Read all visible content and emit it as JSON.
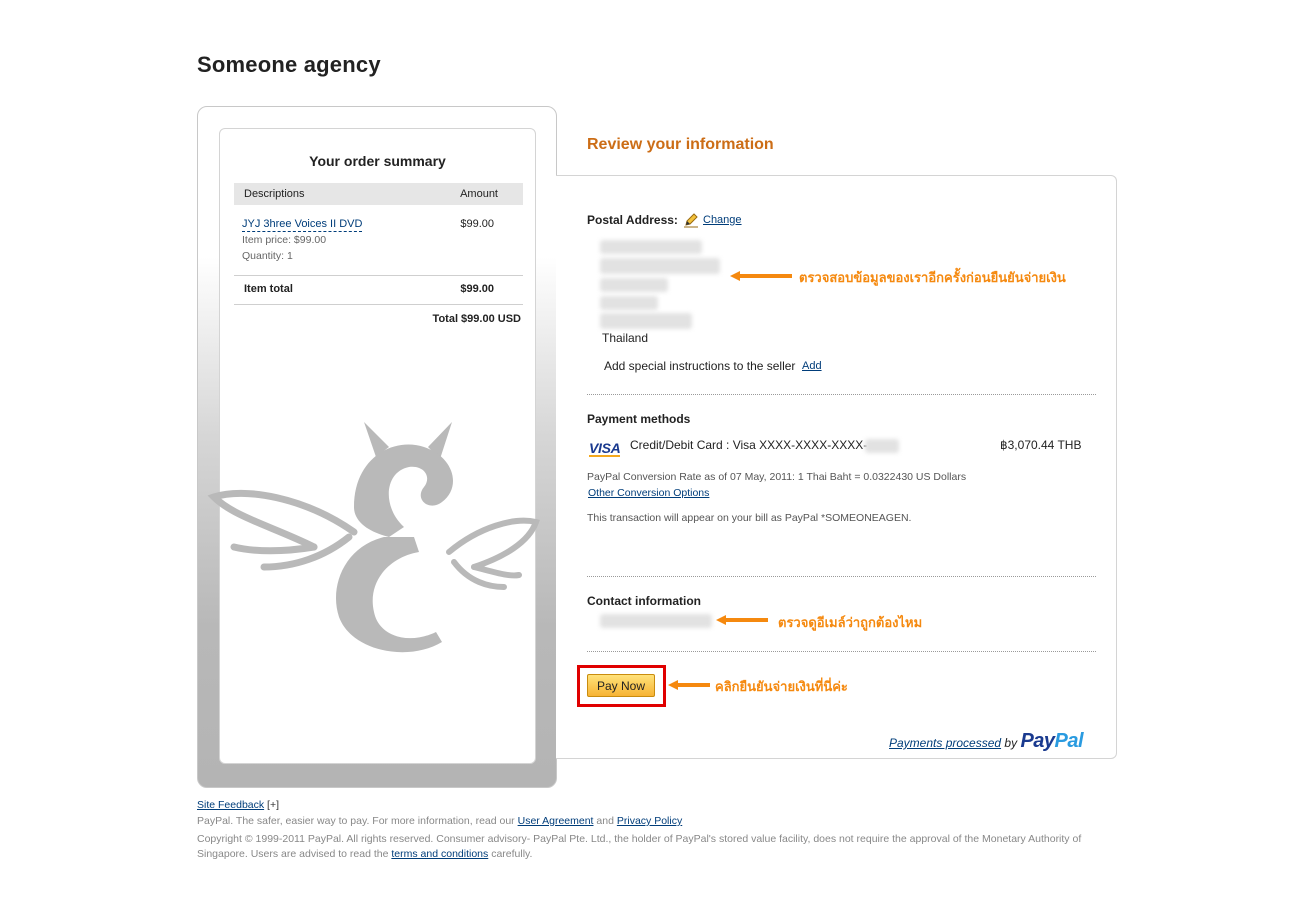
{
  "merchant": {
    "name": "Someone agency"
  },
  "order_summary": {
    "title": "Your order summary",
    "col_description": "Descriptions",
    "col_amount": "Amount",
    "item": {
      "name": "JYJ 3hree Voices II DVD",
      "amount": "$99.00",
      "price": "Item price: $99.00",
      "quantity": "Quantity: 1"
    },
    "item_total_label": "Item total",
    "item_total_value": "$99.00",
    "grand_total": "Total $99.00 USD"
  },
  "review": {
    "heading": "Review your information",
    "postal_label": "Postal Address:",
    "change_link": "Change",
    "country": "Thailand",
    "instructions": "Add special instructions to the seller",
    "add_link": "Add",
    "payment_label": "Payment methods",
    "visa_text": "VISA",
    "card_description": "Credit/Debit Card : Visa XXXX-XXXX-XXXX-",
    "card_amount": "฿3,070.44 THB",
    "conversion_rate": "PayPal Conversion Rate as of 07 May, 2011: 1 Thai Baht = 0.0322430 US Dollars",
    "other_options": "Other Conversion Options",
    "bill_text": "This transaction will appear on your bill as PayPal *SOMEONEAGEN.",
    "contact_label": "Contact information",
    "pay_button": "Pay Now",
    "payments_processed": "Payments processed",
    "by": "by",
    "paypal_pay": "Pay",
    "paypal_pal": "Pal"
  },
  "annotations": {
    "address_note": "ตรวจสอบข้อมูลของเราอีกครั้งก่อนยืนยันจ่ายเงิน",
    "email_note": "ตรวจดูอีเมล์ว่าถูกต้องไหม",
    "pay_note": "คลิกยืนยันจ่ายเงินที่นี่ค่ะ"
  },
  "footer": {
    "site_feedback": "Site Feedback",
    "feedback_plus": "[+]",
    "line1_prefix": "PayPal. The safer, easier way to pay. For more information, read our",
    "user_agreement": "User Agreement",
    "and": "and",
    "privacy_policy": "Privacy Policy",
    "copyright": "Copyright © 1999-2011 PayPal. All rights reserved. Consumer advisory- PayPal Pte. Ltd., the holder of PayPal's stored value facility, does not require the approval of the Monetary Authority of Singapore. Users are advised to read the",
    "terms": "terms and conditions",
    "carefully": "carefully."
  },
  "colors": {
    "heading_orange": "#cc6d16",
    "annotation_orange": "#f5890f",
    "highlight_red": "#e00000",
    "link_blue": "#003d7a"
  }
}
